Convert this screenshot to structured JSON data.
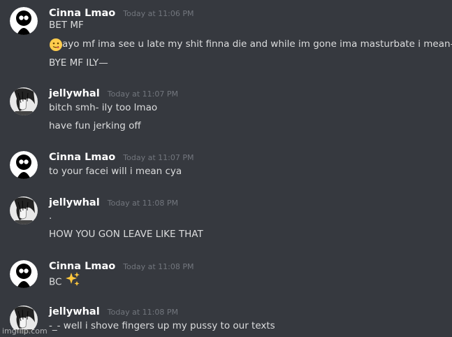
{
  "messages": [
    {
      "user": "Cinna Lmao",
      "avatar": "cinna-avatar",
      "time": "Today at 11:06 PM",
      "lines": [
        "BET MF",
        "ayo mf ima see u late my shit finna die and while im gone ima masturbate i mean—",
        "BYE MF ILY—"
      ],
      "line2_emoji": "slightly-smiling-tongue-emoji"
    },
    {
      "user": "jellywhal",
      "avatar": "jellywhal-avatar",
      "time": "Today at 11:07 PM",
      "lines": [
        "bitch smh- ily too lmao",
        "have fun jerking off"
      ]
    },
    {
      "user": "Cinna Lmao",
      "avatar": "cinna-avatar",
      "time": "Today at 11:07 PM",
      "lines": [
        "to your facei will i mean cya"
      ]
    },
    {
      "user": "jellywhal",
      "avatar": "jellywhal-avatar",
      "time": "Today at 11:08 PM",
      "lines": [
        ".",
        "HOW YOU GON LEAVE LIKE THAT"
      ]
    },
    {
      "user": "Cinna Lmao",
      "avatar": "cinna-avatar",
      "time": "Today at 11:08 PM",
      "lines": [
        "BC"
      ],
      "line1_emoji": "sparkles-emoji"
    },
    {
      "user": "jellywhal",
      "avatar": "jellywhal-avatar",
      "time": "Today at 11:08 PM",
      "lines": [
        "-_- well i shove fingers up my pussy to our texts"
      ]
    }
  ],
  "watermark": "imgflip.com",
  "colors": {
    "background": "#36393f",
    "username": "#ffffff",
    "message_text": "#dcddde",
    "timestamp": "#72767d"
  }
}
